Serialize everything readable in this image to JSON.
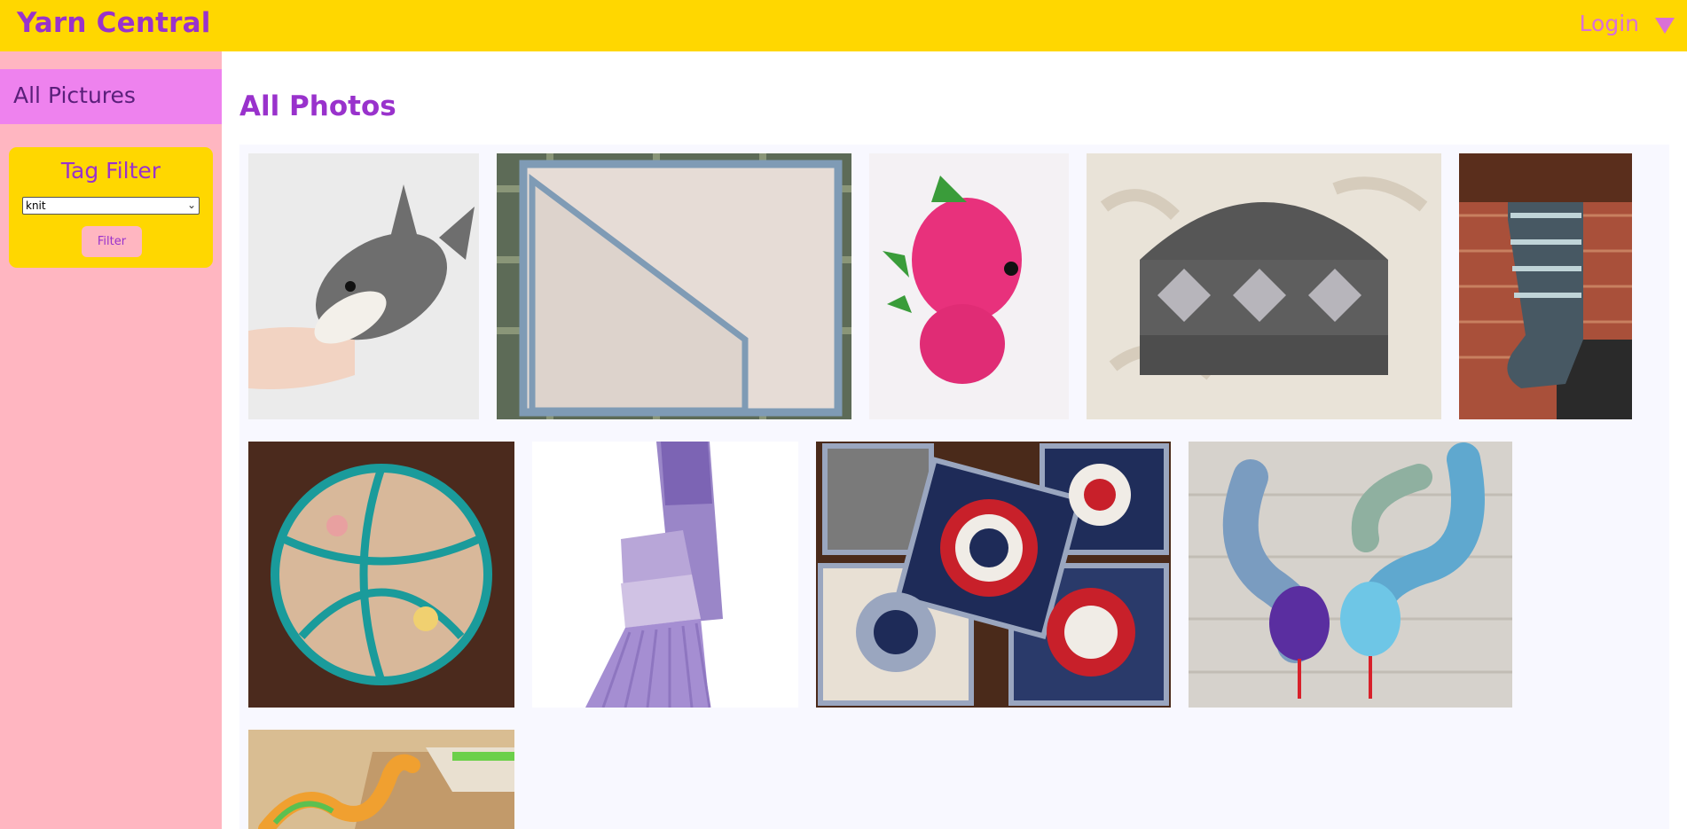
{
  "header": {
    "brand": "Yarn Central",
    "login_label": "Login"
  },
  "sidebar": {
    "nav_all_pictures": "All Pictures",
    "tag_filter": {
      "title": "Tag Filter",
      "selected": "knit",
      "button_label": "Filter"
    }
  },
  "main": {
    "title": "All Photos",
    "photos": [
      {
        "subject": "crocheted gray shark"
      },
      {
        "subject": "cream knit blanket with blue border"
      },
      {
        "subject": "pink crocheted dinosaur"
      },
      {
        "subject": "gray fair isle snowflake hat"
      },
      {
        "subject": "knit christmas stocking"
      },
      {
        "subject": "crocheted teal puzzle ball"
      },
      {
        "subject": "purple gradient knit scarf"
      },
      {
        "subject": "red white navy granny squares"
      },
      {
        "subject": "crocheted striped snakes"
      },
      {
        "subject": "crocheted snake on blanket"
      }
    ]
  },
  "colors": {
    "header_bg": "#FFD700",
    "brand": "#9932CC",
    "login": "#DA70D6",
    "sidebar_bg": "#FFB6C1",
    "nav_active_bg": "#EE82EE",
    "gallery_bg": "#F8F8FF"
  }
}
